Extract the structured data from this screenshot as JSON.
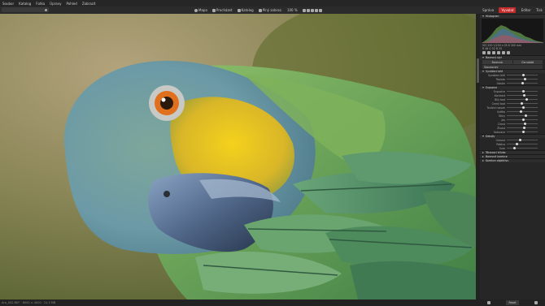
{
  "menubar": {
    "items": [
      "Soubor",
      "Katalog",
      "Fotka",
      "Úpravy",
      "Pohled",
      "Zobrazit"
    ]
  },
  "toolbar": {
    "items": [
      {
        "icon": "pin-icon",
        "label": "Mapa"
      },
      {
        "icon": "folder-icon",
        "label": "Procházet"
      },
      {
        "icon": "grid-icon",
        "label": "Katalog"
      },
      {
        "icon": "crop-icon",
        "label": "Plný zobraz."
      }
    ],
    "zoom": "100 %"
  },
  "tabs": {
    "items": [
      "Správa",
      "Vyvolat",
      "Editor",
      "Tisk"
    ],
    "active": "Vyvolat"
  },
  "panel": {
    "histogram_title": "Histogram",
    "hist_info_1": "ISO 200 1/250 s f/5.6 300 mm",
    "hist_info_2": "R 48  G 52  B 35",
    "preset_section": "Barevný styl",
    "preset_buttons": [
      "Barevná",
      "Černobílá"
    ],
    "preset_dropdown": "Standardní",
    "basic_section": "Vyvážení bílé",
    "wb_rows": [
      "Vyvážení bílé",
      "Teplota",
      "Odstín"
    ],
    "exposure_section": "Expozice",
    "exposure_rows": [
      "Expozice",
      "Kontrast",
      "Bílý bod",
      "Černý bod",
      "Tonální rozsah",
      "Světla",
      "Stíny",
      "Jas",
      "Čirost",
      "Živost",
      "Saturace"
    ],
    "detail_section": "Detaily",
    "detail_rows": [
      "Ostrost",
      "Rádius",
      "Šum"
    ],
    "closed_sections": [
      "Tónovací křivka",
      "Barevné korekce",
      "Korekce objektivu"
    ],
    "footer_label": "Reset"
  },
  "statusbar": "Ara_002.NEF · 6000 × 4000 · 24,5 MB"
}
